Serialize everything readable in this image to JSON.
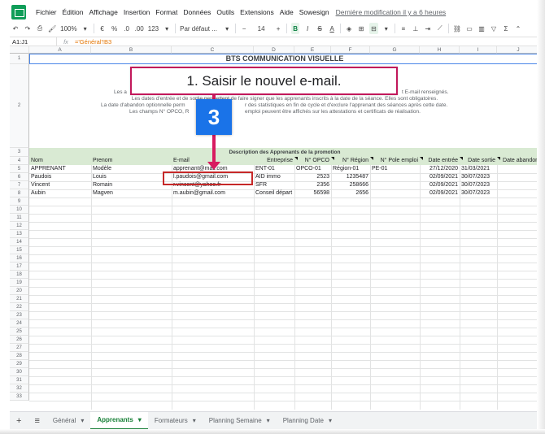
{
  "menu": {
    "items": [
      "Fichier",
      "Édition",
      "Affichage",
      "Insertion",
      "Format",
      "Données",
      "Outils",
      "Extensions",
      "Aide",
      "Sowesign"
    ],
    "last_modified": "Dernière modification il y a 6 heures"
  },
  "toolbar": {
    "zoom": "100%",
    "euro": "€",
    "percent": "%",
    "dec_less": ".0",
    "dec_more": ".00",
    "more_formats": "123",
    "font": "Par défaut ...",
    "font_size": "14",
    "bold": "B"
  },
  "formula_bar": {
    "cell_ref": "A1:J1",
    "fx": "fx",
    "formula": "='Général'!B3"
  },
  "columns": [
    "A",
    "B",
    "C",
    "D",
    "E",
    "F",
    "G",
    "H",
    "I",
    "J"
  ],
  "rows": [
    "1",
    "2",
    "3",
    "4",
    "5",
    "6",
    "7",
    "8",
    "9",
    "10",
    "11",
    "12",
    "13",
    "14",
    "15",
    "16",
    "17",
    "18",
    "19",
    "20",
    "21",
    "22",
    "23",
    "24",
    "25",
    "26",
    "27",
    "28",
    "29",
    "30",
    "31",
    "32",
    "33"
  ],
  "sheet": {
    "title": "BTS COMMUNICATION VISUELLE",
    "desc_line1_left": "Les a",
    "desc_line1_right": "t E-mail renseignés.",
    "desc_line2_left": "Les dates d'entrée et de sortie permettent de faire signer que les apprenants inscrits à la date de la séance. Elles sont obligatoires.",
    "desc_line3": "La date d'abandon optionnelle perm",
    "desc_line3b": "r des statistiques en fin de cycle et d'exclure l'apprenant des séances après cette date.",
    "desc_line4": "Les champs N° OPCO, R",
    "desc_line4b": "emploi peuvent être affichés sur les attestations et certificats de réalisation.",
    "section_title": "Description des Apprenants de la promotion",
    "headers": [
      "Nom",
      "Prenom",
      "E-mail",
      "Entreprise",
      "N° OPCO",
      "N° Région",
      "N° Pole emploi",
      "Date entrée",
      "Date sortie",
      "Date abandon"
    ],
    "data": [
      [
        "APPRENANT",
        "Modèle",
        "apprenant@mail.com",
        "ENT-01",
        "OPCO-01",
        "Région-01",
        "PE-01",
        "27/12/2020",
        "31/03/2021",
        ""
      ],
      [
        "Paudois",
        "Louis",
        "l.paudois@gmail.com",
        "AID immo",
        "2523",
        "1235487",
        "",
        "02/09/2021",
        "30/07/2023",
        ""
      ],
      [
        "Vincent",
        "Romain",
        "r.vincent@yahoo.fr",
        "SFR",
        "2356",
        "258666",
        "",
        "02/09/2021",
        "30/07/2023",
        ""
      ],
      [
        "Aubin",
        "Magven",
        "m.aubin@gmail.com",
        "Conseil départ",
        "56598",
        "2656",
        "",
        "02/09/2021",
        "30/07/2023",
        ""
      ]
    ]
  },
  "annotation": {
    "callout_text": "1. Saisir le nouvel e-mail.",
    "step_number": "3",
    "accent_color": "#d81b60",
    "badge_color": "#1a73e8"
  },
  "tabs": {
    "items": [
      "Général",
      "Apprenants",
      "Formateurs",
      "Planning Semaine",
      "Planning Date"
    ],
    "active": "Apprenants"
  }
}
